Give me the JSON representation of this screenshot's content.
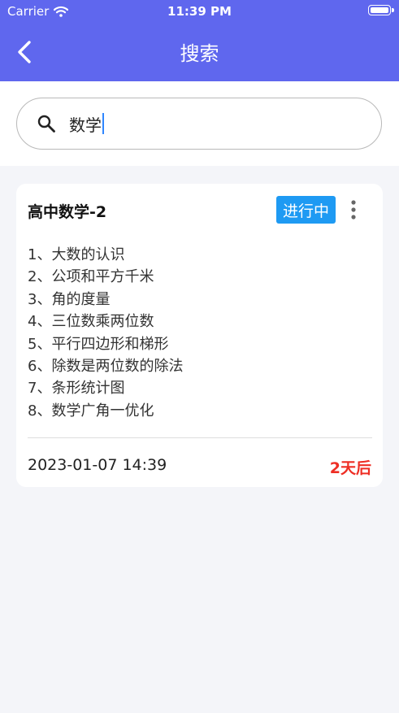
{
  "status_bar": {
    "carrier": "Carrier",
    "time": "11:39 PM"
  },
  "nav": {
    "title": "搜索"
  },
  "search": {
    "query": "数学"
  },
  "card": {
    "title": "高中数学-2",
    "status": "进行中",
    "outline": [
      "1、大数的认识",
      "2、公项和平方千米",
      "3、角的度量",
      "4、三位数乘两位数",
      "5、平行四边形和梯形",
      "6、除数是两位数的除法",
      "7、条形统计图",
      "8、数学广角一优化"
    ],
    "date": "2023-01-07 14:39",
    "due": "2天后"
  },
  "colors": {
    "header": "#5f67ee",
    "badge": "#1e9af3",
    "due": "#ee2e24",
    "caret": "#2f87ff"
  }
}
